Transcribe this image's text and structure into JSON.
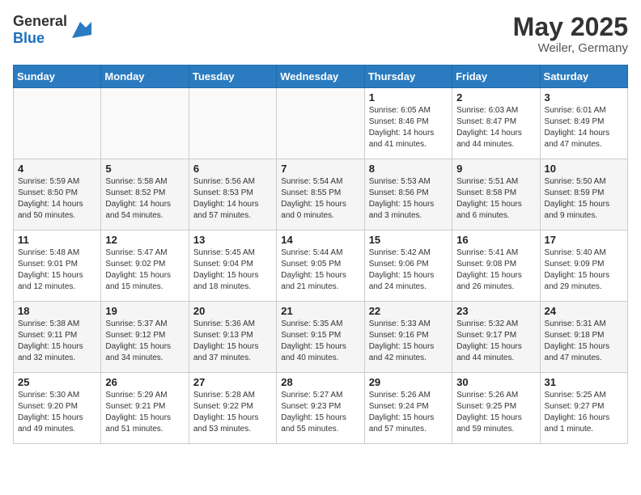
{
  "header": {
    "logo_general": "General",
    "logo_blue": "Blue",
    "title": "May 2025",
    "subtitle": "Weiler, Germany"
  },
  "days_of_week": [
    "Sunday",
    "Monday",
    "Tuesday",
    "Wednesday",
    "Thursday",
    "Friday",
    "Saturday"
  ],
  "weeks": [
    [
      {
        "day": "",
        "info": ""
      },
      {
        "day": "",
        "info": ""
      },
      {
        "day": "",
        "info": ""
      },
      {
        "day": "",
        "info": ""
      },
      {
        "day": "1",
        "info": "Sunrise: 6:05 AM\nSunset: 8:46 PM\nDaylight: 14 hours\nand 41 minutes."
      },
      {
        "day": "2",
        "info": "Sunrise: 6:03 AM\nSunset: 8:47 PM\nDaylight: 14 hours\nand 44 minutes."
      },
      {
        "day": "3",
        "info": "Sunrise: 6:01 AM\nSunset: 8:49 PM\nDaylight: 14 hours\nand 47 minutes."
      }
    ],
    [
      {
        "day": "4",
        "info": "Sunrise: 5:59 AM\nSunset: 8:50 PM\nDaylight: 14 hours\nand 50 minutes."
      },
      {
        "day": "5",
        "info": "Sunrise: 5:58 AM\nSunset: 8:52 PM\nDaylight: 14 hours\nand 54 minutes."
      },
      {
        "day": "6",
        "info": "Sunrise: 5:56 AM\nSunset: 8:53 PM\nDaylight: 14 hours\nand 57 minutes."
      },
      {
        "day": "7",
        "info": "Sunrise: 5:54 AM\nSunset: 8:55 PM\nDaylight: 15 hours\nand 0 minutes."
      },
      {
        "day": "8",
        "info": "Sunrise: 5:53 AM\nSunset: 8:56 PM\nDaylight: 15 hours\nand 3 minutes."
      },
      {
        "day": "9",
        "info": "Sunrise: 5:51 AM\nSunset: 8:58 PM\nDaylight: 15 hours\nand 6 minutes."
      },
      {
        "day": "10",
        "info": "Sunrise: 5:50 AM\nSunset: 8:59 PM\nDaylight: 15 hours\nand 9 minutes."
      }
    ],
    [
      {
        "day": "11",
        "info": "Sunrise: 5:48 AM\nSunset: 9:01 PM\nDaylight: 15 hours\nand 12 minutes."
      },
      {
        "day": "12",
        "info": "Sunrise: 5:47 AM\nSunset: 9:02 PM\nDaylight: 15 hours\nand 15 minutes."
      },
      {
        "day": "13",
        "info": "Sunrise: 5:45 AM\nSunset: 9:04 PM\nDaylight: 15 hours\nand 18 minutes."
      },
      {
        "day": "14",
        "info": "Sunrise: 5:44 AM\nSunset: 9:05 PM\nDaylight: 15 hours\nand 21 minutes."
      },
      {
        "day": "15",
        "info": "Sunrise: 5:42 AM\nSunset: 9:06 PM\nDaylight: 15 hours\nand 24 minutes."
      },
      {
        "day": "16",
        "info": "Sunrise: 5:41 AM\nSunset: 9:08 PM\nDaylight: 15 hours\nand 26 minutes."
      },
      {
        "day": "17",
        "info": "Sunrise: 5:40 AM\nSunset: 9:09 PM\nDaylight: 15 hours\nand 29 minutes."
      }
    ],
    [
      {
        "day": "18",
        "info": "Sunrise: 5:38 AM\nSunset: 9:11 PM\nDaylight: 15 hours\nand 32 minutes."
      },
      {
        "day": "19",
        "info": "Sunrise: 5:37 AM\nSunset: 9:12 PM\nDaylight: 15 hours\nand 34 minutes."
      },
      {
        "day": "20",
        "info": "Sunrise: 5:36 AM\nSunset: 9:13 PM\nDaylight: 15 hours\nand 37 minutes."
      },
      {
        "day": "21",
        "info": "Sunrise: 5:35 AM\nSunset: 9:15 PM\nDaylight: 15 hours\nand 40 minutes."
      },
      {
        "day": "22",
        "info": "Sunrise: 5:33 AM\nSunset: 9:16 PM\nDaylight: 15 hours\nand 42 minutes."
      },
      {
        "day": "23",
        "info": "Sunrise: 5:32 AM\nSunset: 9:17 PM\nDaylight: 15 hours\nand 44 minutes."
      },
      {
        "day": "24",
        "info": "Sunrise: 5:31 AM\nSunset: 9:18 PM\nDaylight: 15 hours\nand 47 minutes."
      }
    ],
    [
      {
        "day": "25",
        "info": "Sunrise: 5:30 AM\nSunset: 9:20 PM\nDaylight: 15 hours\nand 49 minutes."
      },
      {
        "day": "26",
        "info": "Sunrise: 5:29 AM\nSunset: 9:21 PM\nDaylight: 15 hours\nand 51 minutes."
      },
      {
        "day": "27",
        "info": "Sunrise: 5:28 AM\nSunset: 9:22 PM\nDaylight: 15 hours\nand 53 minutes."
      },
      {
        "day": "28",
        "info": "Sunrise: 5:27 AM\nSunset: 9:23 PM\nDaylight: 15 hours\nand 55 minutes."
      },
      {
        "day": "29",
        "info": "Sunrise: 5:26 AM\nSunset: 9:24 PM\nDaylight: 15 hours\nand 57 minutes."
      },
      {
        "day": "30",
        "info": "Sunrise: 5:26 AM\nSunset: 9:25 PM\nDaylight: 15 hours\nand 59 minutes."
      },
      {
        "day": "31",
        "info": "Sunrise: 5:25 AM\nSunset: 9:27 PM\nDaylight: 16 hours\nand 1 minute."
      }
    ]
  ]
}
